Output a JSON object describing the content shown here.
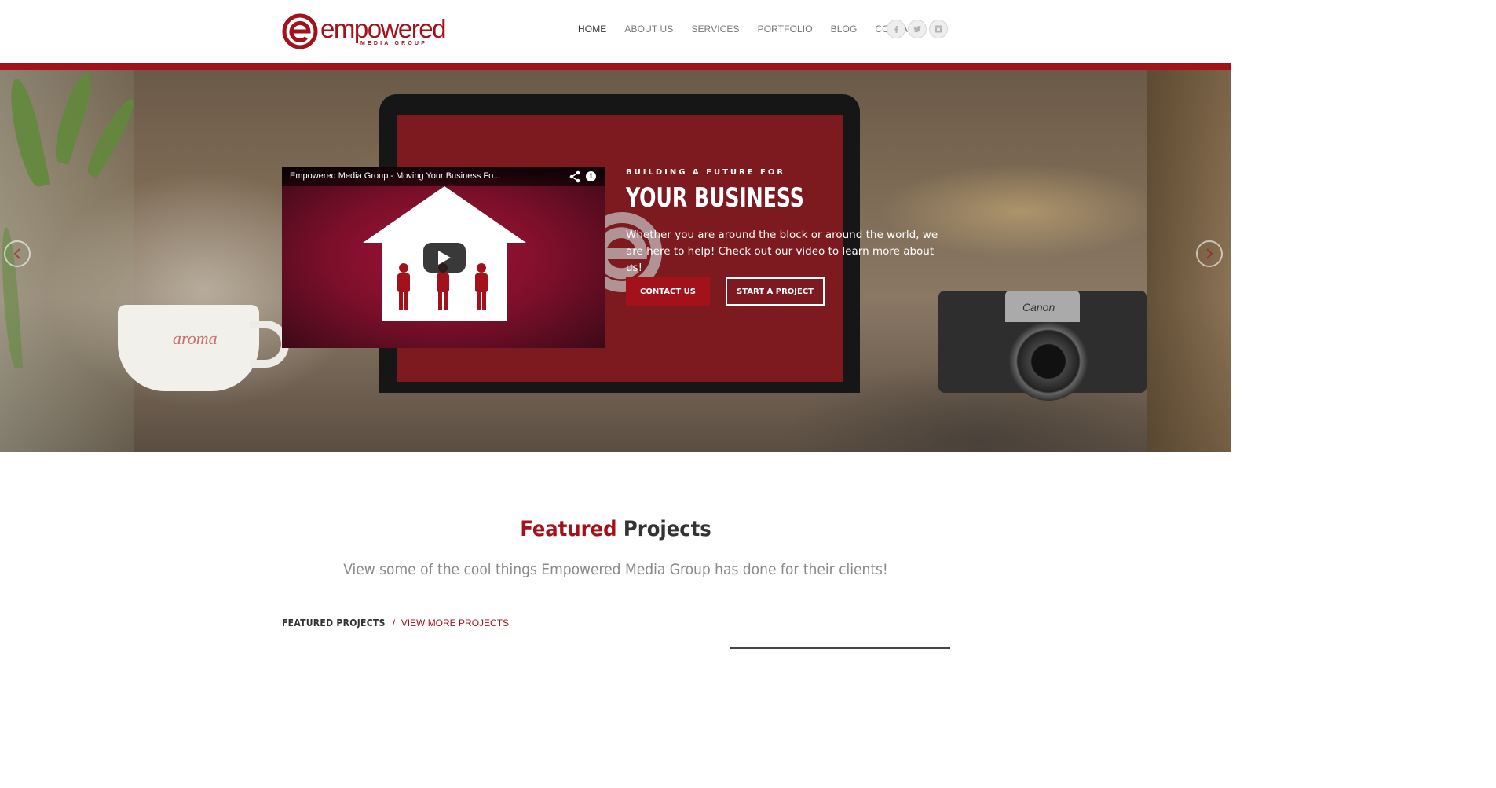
{
  "header": {
    "logo_word": "empowered",
    "logo_sub": "MEDIA GROUP",
    "nav": [
      "HOME",
      "ABOUT US",
      "SERVICES",
      "PORTFOLIO",
      "BLOG",
      "CONTACT"
    ],
    "social_icons": [
      "facebook-icon",
      "twitter-icon",
      "instagram-icon"
    ]
  },
  "hero": {
    "video_title": "Empowered Media Group - Moving Your Business Fo...",
    "kicker": "BUILDING A FUTURE FOR",
    "title": "YOUR BUSINESS",
    "text": "Whether you are around the block or around the world, we are here to help! Check out our video to learn more about us!",
    "btn_contact": "CONTACT US",
    "btn_start": "START A PROJECT",
    "cup_text": "aroma",
    "camera_brand": "Canon"
  },
  "featured": {
    "heading_word1": "Featured",
    "heading_word2": "Projects",
    "subheading": "View some of the cool things Empowered Media Group has done for their clients!",
    "bar_label": "FEATURED PROJECTS",
    "bar_sep": "/",
    "bar_link": "VIEW MORE PROJECTS"
  },
  "colors": {
    "brand_red": "#a3121a",
    "nav_text": "#777777",
    "nav_active": "#333333"
  }
}
